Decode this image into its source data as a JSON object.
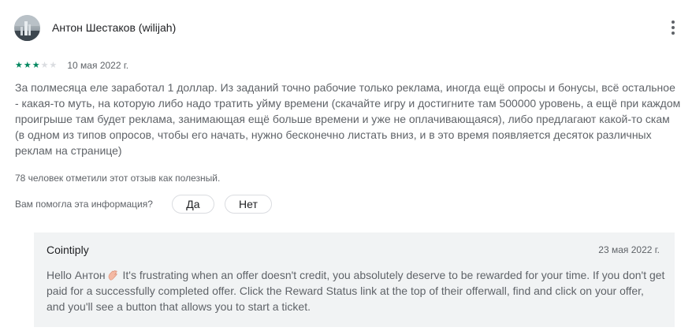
{
  "review": {
    "author": "Антон Шестаков (wilijah)",
    "avatar_icon": "avatar-photo",
    "menu_icon": "more-vert-icon",
    "rating": 3,
    "max_rating": 5,
    "star_color": "#01875f",
    "date": "10 мая 2022 г.",
    "text": "За полмесяца еле заработал 1 доллар. Из заданий точно рабочие только реклама, иногда ещё опросы и бонусы, всё остальное - какая-то муть, на которую либо надо тратить уйму времени (скачайте игру и достигните там 500000 уровень, а ещё при каждом проигрыше там будет реклама, занимающая ещё больше времени и уже не оплачивающаяся), либо предлагают какой-то скам (в одном из типов опросов, чтобы его начать, нужно бесконечно листать вниз, и в это время появляется десяток различных реклам на странице)",
    "helpful_count": "78 человек отметили этот отзыв как полезный.",
    "helpful_question": "Вам помогла эта информация?",
    "yes_label": "Да",
    "no_label": "Нет"
  },
  "reply": {
    "author": "Cointiply",
    "date": "23 мая 2022 г.",
    "greeting": "Hello Антон",
    "wave_icon": "waving-hand-icon",
    "text": "It's frustrating when an offer doesn't credit, you absolutely deserve to be rewarded for your time. If you don't get paid for a successfully completed offer. Click the Reward Status link at the top of their offerwall, find and click on your offer, and you'll see a button that allows you to start a ticket."
  }
}
